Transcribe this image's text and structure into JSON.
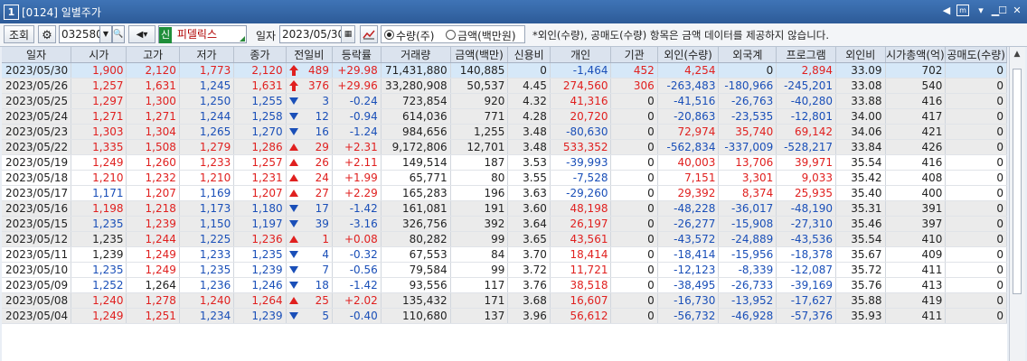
{
  "window": {
    "number": "1",
    "title": "[0124] 일별주가"
  },
  "toolbar": {
    "query_label": "조회",
    "code_value": "032580",
    "market_badge": "신",
    "stock_name": "피델릭스",
    "date_label": "일자",
    "date_value": "2023/05/30",
    "radio_qty_label": "수량(주)",
    "radio_amt_label": "금액(백만원)",
    "notice": "*외인(수량), 공매도(수량) 항목은 금액 데이터를 제공하지 않습니다."
  },
  "table": {
    "headers": [
      "일자",
      "시가",
      "고가",
      "저가",
      "종가",
      "전일비",
      "등락률",
      "거래량",
      "금액(백만)",
      "신용비",
      "개인",
      "기관",
      "외인(수량)",
      "외국계",
      "프로그램",
      "외인비",
      "시가총액(억)",
      "공매도(수량)"
    ],
    "rows": [
      {
        "date": "2023/05/30",
        "open": "1,900",
        "high": "2,120",
        "low": "1,773",
        "close": "2,120",
        "dir": "upper",
        "diff": "489",
        "rate": "+29.98",
        "vol": "71,431,880",
        "amt": "140,885",
        "credit": "0",
        "indiv": "-1,464",
        "inst": "452",
        "foreign": "4,254",
        "fcomp": "0",
        "prog": "2,894",
        "fratio": "33.09",
        "mcap": "702",
        "short": "0"
      },
      {
        "date": "2023/05/26",
        "open": "1,257",
        "high": "1,631",
        "low": "1,245",
        "close": "1,631",
        "dir": "upper",
        "diff": "376",
        "rate": "+29.96",
        "vol": "33,280,908",
        "amt": "50,537",
        "credit": "4.45",
        "indiv": "274,560",
        "inst": "306",
        "foreign": "-263,483",
        "fcomp": "-180,966",
        "prog": "-245,201",
        "fratio": "33.08",
        "mcap": "540",
        "short": "0"
      },
      {
        "date": "2023/05/25",
        "open": "1,297",
        "high": "1,300",
        "low": "1,250",
        "close": "1,255",
        "dir": "down",
        "diff": "3",
        "rate": "-0.24",
        "vol": "723,854",
        "amt": "920",
        "credit": "4.32",
        "indiv": "41,316",
        "inst": "0",
        "foreign": "-41,516",
        "fcomp": "-26,763",
        "prog": "-40,280",
        "fratio": "33.88",
        "mcap": "416",
        "short": "0"
      },
      {
        "date": "2023/05/24",
        "open": "1,271",
        "high": "1,271",
        "low": "1,244",
        "close": "1,258",
        "dir": "down",
        "diff": "12",
        "rate": "-0.94",
        "vol": "614,036",
        "amt": "771",
        "credit": "4.28",
        "indiv": "20,720",
        "inst": "0",
        "foreign": "-20,863",
        "fcomp": "-23,535",
        "prog": "-12,801",
        "fratio": "34.00",
        "mcap": "417",
        "short": "0"
      },
      {
        "date": "2023/05/23",
        "open": "1,303",
        "high": "1,304",
        "low": "1,265",
        "close": "1,270",
        "dir": "down",
        "diff": "16",
        "rate": "-1.24",
        "vol": "984,656",
        "amt": "1,255",
        "credit": "3.48",
        "indiv": "-80,630",
        "inst": "0",
        "foreign": "72,974",
        "fcomp": "35,740",
        "prog": "69,142",
        "fratio": "34.06",
        "mcap": "421",
        "short": "0"
      },
      {
        "date": "2023/05/22",
        "open": "1,335",
        "high": "1,508",
        "low": "1,279",
        "close": "1,286",
        "dir": "up",
        "diff": "29",
        "rate": "+2.31",
        "vol": "9,172,806",
        "amt": "12,701",
        "credit": "3.48",
        "indiv": "533,352",
        "inst": "0",
        "foreign": "-562,834",
        "fcomp": "-337,009",
        "prog": "-528,217",
        "fratio": "33.84",
        "mcap": "426",
        "short": "0"
      },
      {
        "date": "2023/05/19",
        "open": "1,249",
        "high": "1,260",
        "low": "1,233",
        "close": "1,257",
        "dir": "up",
        "diff": "26",
        "rate": "+2.11",
        "vol": "149,514",
        "amt": "187",
        "credit": "3.53",
        "indiv": "-39,993",
        "inst": "0",
        "foreign": "40,003",
        "fcomp": "13,706",
        "prog": "39,971",
        "fratio": "35.54",
        "mcap": "416",
        "short": "0"
      },
      {
        "date": "2023/05/18",
        "open": "1,210",
        "high": "1,232",
        "low": "1,210",
        "close": "1,231",
        "dir": "up",
        "diff": "24",
        "rate": "+1.99",
        "vol": "65,771",
        "amt": "80",
        "credit": "3.55",
        "indiv": "-7,528",
        "inst": "0",
        "foreign": "7,151",
        "fcomp": "3,301",
        "prog": "9,033",
        "fratio": "35.42",
        "mcap": "408",
        "short": "0"
      },
      {
        "date": "2023/05/17",
        "open": "1,171",
        "high": "1,207",
        "low": "1,169",
        "close": "1,207",
        "dir": "up",
        "diff": "27",
        "rate": "+2.29",
        "vol": "165,283",
        "amt": "196",
        "credit": "3.63",
        "indiv": "-29,260",
        "inst": "0",
        "foreign": "29,392",
        "fcomp": "8,374",
        "prog": "25,935",
        "fratio": "35.40",
        "mcap": "400",
        "short": "0"
      },
      {
        "date": "2023/05/16",
        "open": "1,198",
        "high": "1,218",
        "low": "1,173",
        "close": "1,180",
        "dir": "down",
        "diff": "17",
        "rate": "-1.42",
        "vol": "161,081",
        "amt": "191",
        "credit": "3.60",
        "indiv": "48,198",
        "inst": "0",
        "foreign": "-48,228",
        "fcomp": "-36,017",
        "prog": "-48,190",
        "fratio": "35.31",
        "mcap": "391",
        "short": "0"
      },
      {
        "date": "2023/05/15",
        "open": "1,235",
        "high": "1,239",
        "low": "1,150",
        "close": "1,197",
        "dir": "down",
        "diff": "39",
        "rate": "-3.16",
        "vol": "326,756",
        "amt": "392",
        "credit": "3.64",
        "indiv": "26,197",
        "inst": "0",
        "foreign": "-26,277",
        "fcomp": "-15,908",
        "prog": "-27,310",
        "fratio": "35.46",
        "mcap": "397",
        "short": "0"
      },
      {
        "date": "2023/05/12",
        "open": "1,235",
        "high": "1,244",
        "low": "1,225",
        "close": "1,236",
        "dir": "up",
        "diff": "1",
        "rate": "+0.08",
        "vol": "80,282",
        "amt": "99",
        "credit": "3.65",
        "indiv": "43,561",
        "inst": "0",
        "foreign": "-43,572",
        "fcomp": "-24,889",
        "prog": "-43,536",
        "fratio": "35.54",
        "mcap": "410",
        "short": "0"
      },
      {
        "date": "2023/05/11",
        "open": "1,239",
        "high": "1,249",
        "low": "1,233",
        "close": "1,235",
        "dir": "down",
        "diff": "4",
        "rate": "-0.32",
        "vol": "67,553",
        "amt": "84",
        "credit": "3.70",
        "indiv": "18,414",
        "inst": "0",
        "foreign": "-18,414",
        "fcomp": "-15,956",
        "prog": "-18,378",
        "fratio": "35.67",
        "mcap": "409",
        "short": "0"
      },
      {
        "date": "2023/05/10",
        "open": "1,235",
        "high": "1,249",
        "low": "1,235",
        "close": "1,239",
        "dir": "down",
        "diff": "7",
        "rate": "-0.56",
        "vol": "79,584",
        "amt": "99",
        "credit": "3.72",
        "indiv": "11,721",
        "inst": "0",
        "foreign": "-12,123",
        "fcomp": "-8,339",
        "prog": "-12,087",
        "fratio": "35.72",
        "mcap": "411",
        "short": "0"
      },
      {
        "date": "2023/05/09",
        "open": "1,252",
        "high": "1,264",
        "low": "1,236",
        "close": "1,246",
        "dir": "down",
        "diff": "18",
        "rate": "-1.42",
        "vol": "93,556",
        "amt": "117",
        "credit": "3.76",
        "indiv": "38,518",
        "inst": "0",
        "foreign": "-38,495",
        "fcomp": "-26,733",
        "prog": "-39,169",
        "fratio": "35.76",
        "mcap": "413",
        "short": "0"
      },
      {
        "date": "2023/05/08",
        "open": "1,240",
        "high": "1,278",
        "low": "1,240",
        "close": "1,264",
        "dir": "up",
        "diff": "25",
        "rate": "+2.02",
        "vol": "135,432",
        "amt": "171",
        "credit": "3.68",
        "indiv": "16,607",
        "inst": "0",
        "foreign": "-16,730",
        "fcomp": "-13,952",
        "prog": "-17,627",
        "fratio": "35.88",
        "mcap": "419",
        "short": "0"
      },
      {
        "date": "2023/05/04",
        "open": "1,249",
        "high": "1,251",
        "low": "1,234",
        "close": "1,239",
        "dir": "down",
        "diff": "5",
        "rate": "-0.40",
        "vol": "110,680",
        "amt": "137",
        "credit": "3.96",
        "indiv": "56,612",
        "inst": "0",
        "foreign": "-56,732",
        "fcomp": "-46,928",
        "prog": "-57,376",
        "fratio": "35.93",
        "mcap": "411",
        "short": "0"
      }
    ]
  },
  "colors": {
    "up": "#e0201f",
    "down": "#1a4fb8",
    "flat": "#222222",
    "selected_row": "#d6e8f8",
    "group_row": "#ebebeb",
    "header_bg": "#dbe3ee",
    "titlebar": "#2d5b98"
  },
  "icons": {
    "settings": "gear-icon",
    "sound": "speaker-icon",
    "calendar": "calendar-icon",
    "chart": "chart-icon",
    "upper": "up-thick-arrow-icon",
    "up": "up-triangle-icon",
    "down": "down-triangle-icon"
  }
}
